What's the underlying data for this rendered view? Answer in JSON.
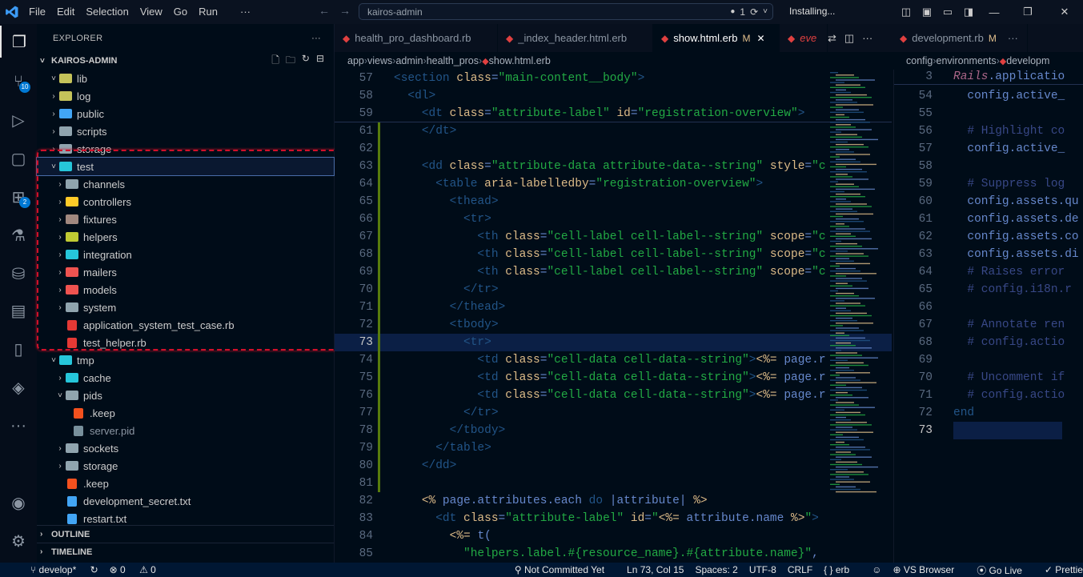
{
  "titlebar": {
    "menu": [
      "File",
      "Edit",
      "Selection",
      "View",
      "Go",
      "Run",
      "···"
    ],
    "search": "kairos-admin",
    "changes": "1",
    "status": "Installing..."
  },
  "activity": {
    "source_control_badge": "10",
    "extensions_badge": "2"
  },
  "explorer": {
    "title": "EXPLORER",
    "project": "KAIROS-ADMIN",
    "rows": [
      {
        "label": "lib",
        "depth": 1,
        "chev": "˅",
        "color": "#c5c35a"
      },
      {
        "label": "log",
        "depth": 1,
        "chev": "›",
        "color": "#c5c35a"
      },
      {
        "label": "public",
        "depth": 1,
        "chev": "›",
        "color": "#42a5f5"
      },
      {
        "label": "scripts",
        "depth": 1,
        "chev": "›",
        "color": "#90a4ae"
      },
      {
        "label": "storage",
        "depth": 1,
        "chev": "›",
        "color": "#90a4ae"
      },
      {
        "label": "test",
        "depth": 1,
        "chev": "˅",
        "color": "#26c6da",
        "selected": true
      },
      {
        "label": "channels",
        "depth": 2,
        "chev": "›",
        "color": "#90a4ae"
      },
      {
        "label": "controllers",
        "depth": 2,
        "chev": "›",
        "color": "#ffca28"
      },
      {
        "label": "fixtures",
        "depth": 2,
        "chev": "›",
        "color": "#a1887f"
      },
      {
        "label": "helpers",
        "depth": 2,
        "chev": "›",
        "color": "#c0ca33"
      },
      {
        "label": "integration",
        "depth": 2,
        "chev": "›",
        "color": "#26c6da"
      },
      {
        "label": "mailers",
        "depth": 2,
        "chev": "›",
        "color": "#ef5350"
      },
      {
        "label": "models",
        "depth": 2,
        "chev": "›",
        "color": "#ef5350"
      },
      {
        "label": "system",
        "depth": 2,
        "chev": "›",
        "color": "#90a4ae"
      },
      {
        "label": "application_system_test_case.rb",
        "depth": 2,
        "chev": "",
        "color": "#e53935",
        "file": true
      },
      {
        "label": "test_helper.rb",
        "depth": 2,
        "chev": "",
        "color": "#e53935",
        "file": true
      },
      {
        "label": "tmp",
        "depth": 1,
        "chev": "˅",
        "color": "#26c6da"
      },
      {
        "label": "cache",
        "depth": 2,
        "chev": "›",
        "color": "#26c6da"
      },
      {
        "label": "pids",
        "depth": 2,
        "chev": "˅",
        "color": "#90a4ae"
      },
      {
        "label": ".keep",
        "depth": 3,
        "chev": "",
        "color": "#f4511e",
        "file": true
      },
      {
        "label": "server.pid",
        "depth": 3,
        "chev": "",
        "color": "#78909c",
        "file": true,
        "dim": true
      },
      {
        "label": "sockets",
        "depth": 2,
        "chev": "›",
        "color": "#90a4ae"
      },
      {
        "label": "storage",
        "depth": 2,
        "chev": "›",
        "color": "#90a4ae"
      },
      {
        "label": ".keep",
        "depth": 2,
        "chev": "",
        "color": "#f4511e",
        "file": true
      },
      {
        "label": "development_secret.txt",
        "depth": 2,
        "chev": "",
        "color": "#42a5f5",
        "file": true
      },
      {
        "label": "restart.txt",
        "depth": 2,
        "chev": "",
        "color": "#42a5f5",
        "file": true
      }
    ],
    "outline": "OUTLINE",
    "timeline": "TIMELINE"
  },
  "tabs": [
    {
      "label": "health_pro_dashboard.rb",
      "mod": "",
      "active": false
    },
    {
      "label": "_index_header.html.erb",
      "mod": "",
      "active": false
    },
    {
      "label": "show.html.erb",
      "mod": "M",
      "active": true
    },
    {
      "label": "eve",
      "mod": "",
      "active": false
    },
    {
      "label": "development.rb",
      "mod": "M",
      "active": false
    }
  ],
  "breadcrumb_left": [
    "app",
    "views",
    "admin",
    "health_pros",
    "show.html.erb"
  ],
  "breadcrumb_right": [
    "config",
    "environments",
    "developm"
  ],
  "code": [
    {
      "n": "57",
      "html": "<span class='t-tag'>&lt;section</span> <span class='t-attr'>class</span>=<span class='t-str'>\"main-content__body\"</span><span class='t-tag'>&gt;</span>",
      "indent": 0
    },
    {
      "n": "58",
      "html": "  <span class='t-tag'>&lt;dl&gt;</span>",
      "indent": 0
    },
    {
      "n": "59",
      "html": "    <span class='t-tag'>&lt;dt</span> <span class='t-attr'>class</span>=<span class='t-str'>\"attribute-label\"</span> <span class='t-attr'>id</span>=<span class='t-str'>\"registration-overview\"</span><span class='t-tag'>&gt;</span>",
      "indent": 0
    },
    {
      "n": "61",
      "html": "    <span class='t-tag'>&lt;/dt&gt;</span>",
      "indent": 0
    },
    {
      "n": "62",
      "html": "",
      "indent": 0
    },
    {
      "n": "63",
      "html": "    <span class='t-tag'>&lt;dd</span> <span class='t-attr'>class</span>=<span class='t-str'>\"attribute-data attribute-data--string\"</span> <span class='t-attr'>style</span>=<span class='t-str'>\"c</span>",
      "indent": 0
    },
    {
      "n": "64",
      "html": "      <span class='t-tag'>&lt;table</span> <span class='t-attr'>aria-labelledby</span>=<span class='t-str'>\"registration-overview\"</span><span class='t-tag'>&gt;</span>",
      "indent": 0
    },
    {
      "n": "65",
      "html": "        <span class='t-tag'>&lt;thead&gt;</span>",
      "indent": 0
    },
    {
      "n": "66",
      "html": "          <span class='t-tag'>&lt;tr&gt;</span>",
      "indent": 0
    },
    {
      "n": "67",
      "html": "            <span class='t-tag'>&lt;th</span> <span class='t-attr'>class</span>=<span class='t-str'>\"cell-label cell-label--string\"</span> <span class='t-attr'>scope</span>=<span class='t-str'>\"c</span>",
      "indent": 0
    },
    {
      "n": "68",
      "html": "            <span class='t-tag'>&lt;th</span> <span class='t-attr'>class</span>=<span class='t-str'>\"cell-label cell-label--string\"</span> <span class='t-attr'>scope</span>=<span class='t-str'>\"c</span>",
      "indent": 0
    },
    {
      "n": "69",
      "html": "            <span class='t-tag'>&lt;th</span> <span class='t-attr'>class</span>=<span class='t-str'>\"cell-label cell-label--string\"</span> <span class='t-attr'>scope</span>=<span class='t-str'>\"c</span>",
      "indent": 0
    },
    {
      "n": "70",
      "html": "          <span class='t-tag'>&lt;/tr&gt;</span>",
      "indent": 0
    },
    {
      "n": "71",
      "html": "        <span class='t-tag'>&lt;/thead&gt;</span>",
      "indent": 0
    },
    {
      "n": "72",
      "html": "        <span class='t-tag'>&lt;tbody&gt;</span>",
      "indent": 0
    },
    {
      "n": "73",
      "html": "          <span class='t-tag'>&lt;tr&gt;</span>",
      "indent": 0,
      "current": true
    },
    {
      "n": "74",
      "html": "            <span class='t-tag'>&lt;td</span> <span class='t-attr'>class</span>=<span class='t-str'>\"cell-data cell-data--string\"</span><span class='t-tag'>&gt;</span><span class='t-erb'>&lt;%=</span> <span class='t-rb'>page.r</span>",
      "indent": 0
    },
    {
      "n": "75",
      "html": "            <span class='t-tag'>&lt;td</span> <span class='t-attr'>class</span>=<span class='t-str'>\"cell-data cell-data--string\"</span><span class='t-tag'>&gt;</span><span class='t-erb'>&lt;%=</span> <span class='t-rb'>page.r</span>",
      "indent": 0
    },
    {
      "n": "76",
      "html": "            <span class='t-tag'>&lt;td</span> <span class='t-attr'>class</span>=<span class='t-str'>\"cell-data cell-data--string\"</span><span class='t-tag'>&gt;</span><span class='t-erb'>&lt;%=</span> <span class='t-rb'>page.r</span>",
      "indent": 0
    },
    {
      "n": "77",
      "html": "          <span class='t-tag'>&lt;/tr&gt;</span>",
      "indent": 0
    },
    {
      "n": "78",
      "html": "        <span class='t-tag'>&lt;/tbody&gt;</span>",
      "indent": 0
    },
    {
      "n": "79",
      "html": "      <span class='t-tag'>&lt;/table&gt;</span>",
      "indent": 0
    },
    {
      "n": "80",
      "html": "    <span class='t-tag'>&lt;/dd&gt;</span>",
      "indent": 0
    },
    {
      "n": "81",
      "html": "",
      "indent": 0
    },
    {
      "n": "82",
      "html": "    <span class='t-erb'>&lt;%</span> <span class='t-rb'>page.attributes.each</span> <span class='t-kw'>do</span> <span class='t-rb'>|attribute|</span> <span class='t-erb'>%&gt;</span>",
      "indent": 0
    },
    {
      "n": "83",
      "html": "      <span class='t-tag'>&lt;dt</span> <span class='t-attr'>class</span>=<span class='t-str'>\"attribute-label\"</span> <span class='t-attr'>id</span>=<span class='t-str'>\"</span><span class='t-erb'>&lt;%=</span> <span class='t-rb'>attribute.name</span> <span class='t-erb'>%&gt;</span><span class='t-str'>\"</span><span class='t-tag'>&gt;</span>",
      "indent": 0
    },
    {
      "n": "84",
      "html": "        <span class='t-erb'>&lt;%=</span> <span class='t-rb'>t(</span>",
      "indent": 0
    },
    {
      "n": "85",
      "html": "          <span class='t-str'>\"helpers.label.#{resource_name}.#{attribute.name}\"</span>,",
      "indent": 0
    }
  ],
  "code_right": [
    {
      "n": "3",
      "html": "<span style='color:#aa6688;font-style:italic'>Rails</span><span class='t-rb'>.applicatio</span>"
    },
    {
      "n": "54",
      "html": "  <span class='t-rb'>config.active_</span>"
    },
    {
      "n": "55",
      "html": ""
    },
    {
      "n": "56",
      "html": "  <span style='color:#384887'># Highlight co</span>"
    },
    {
      "n": "57",
      "html": "  <span class='t-rb'>config.active_</span>"
    },
    {
      "n": "58",
      "html": ""
    },
    {
      "n": "59",
      "html": "  <span style='color:#384887'># Suppress log</span>"
    },
    {
      "n": "60",
      "html": "  <span class='t-rb'>config.assets.qu</span>"
    },
    {
      "n": "61",
      "html": "  <span class='t-rb'>config.assets.de</span>"
    },
    {
      "n": "62",
      "html": "  <span class='t-rb'>config.assets.co</span>"
    },
    {
      "n": "63",
      "html": "  <span class='t-rb'>config.assets.di</span>"
    },
    {
      "n": "64",
      "html": "  <span style='color:#384887'># Raises error</span>"
    },
    {
      "n": "65",
      "html": "  <span style='color:#384887'># config.i18n.r</span>"
    },
    {
      "n": "66",
      "html": ""
    },
    {
      "n": "67",
      "html": "  <span style='color:#384887'># Annotate ren</span>"
    },
    {
      "n": "68",
      "html": "  <span style='color:#384887'># config.actio</span>"
    },
    {
      "n": "69",
      "html": ""
    },
    {
      "n": "70",
      "html": "  <span style='color:#384887'># Uncomment if</span>"
    },
    {
      "n": "71",
      "html": "  <span style='color:#384887'># config.actio</span>"
    },
    {
      "n": "72",
      "html": "<span class='t-kw'>end</span>"
    },
    {
      "n": "73",
      "html": "",
      "current": true
    }
  ],
  "status": {
    "branch": "develop*",
    "errors": "0",
    "warnings": "0",
    "commit": "Not Committed Yet",
    "position": "Ln 73, Col 15",
    "spaces": "Spaces: 2",
    "encoding": "UTF-8",
    "eol": "CRLF",
    "lang": "erb",
    "browser": "VS Browser",
    "golive": "Go Live",
    "prettier": "Prettier"
  }
}
